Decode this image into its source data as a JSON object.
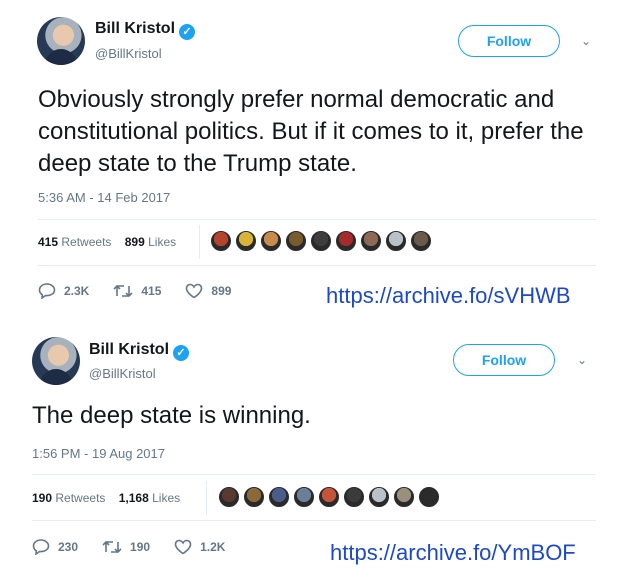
{
  "tweets": [
    {
      "author": {
        "name": "Bill Kristol",
        "handle": "@BillKristol",
        "verified": true
      },
      "follow_label": "Follow",
      "text": "Obviously strongly prefer normal democratic and constitutional politics. But if it comes to it, prefer the deep state to the Trump state.",
      "timestamp": "5:36 AM - 14 Feb 2017",
      "retweets_count": "415",
      "retweets_label": "Retweets",
      "likes_count": "899",
      "likes_label": "Likes",
      "liker_colors": [
        "#b5442f",
        "#d9b23a",
        "#c98a4e",
        "#7a5b2e",
        "#3d3d3d",
        "#a32b2b",
        "#8c6a55",
        "#b9c1c9",
        "#6b5a4a"
      ],
      "reply_count": "2.3K",
      "retweet_count": "415",
      "like_count": "899",
      "archive_link": "https://archive.fo/sVHWB"
    },
    {
      "author": {
        "name": "Bill Kristol",
        "handle": "@BillKristol",
        "verified": true
      },
      "follow_label": "Follow",
      "text": "The deep state is winning.",
      "timestamp": "1:56 PM - 19 Aug 2017",
      "retweets_count": "190",
      "retweets_label": "Retweets",
      "likes_count": "1,168",
      "likes_label": "Likes",
      "liker_colors": [
        "#5a3a2e",
        "#8b6a3a",
        "#4a5d8a",
        "#6c7f99",
        "#c4553a",
        "#3b3b3b",
        "#b9c1c9",
        "#9a8f7a",
        "#2b2b2b"
      ],
      "reply_count": "230",
      "retweet_count": "190",
      "like_count": "1.2K",
      "archive_link": "https://archive.fo/YmBOF"
    }
  ],
  "colors": {
    "accent": "#1da1f2",
    "muted": "#657786",
    "link": "#1d49c8"
  },
  "icons": [
    "verified-icon",
    "caret-down-icon",
    "reply-icon",
    "retweet-icon",
    "like-icon"
  ]
}
